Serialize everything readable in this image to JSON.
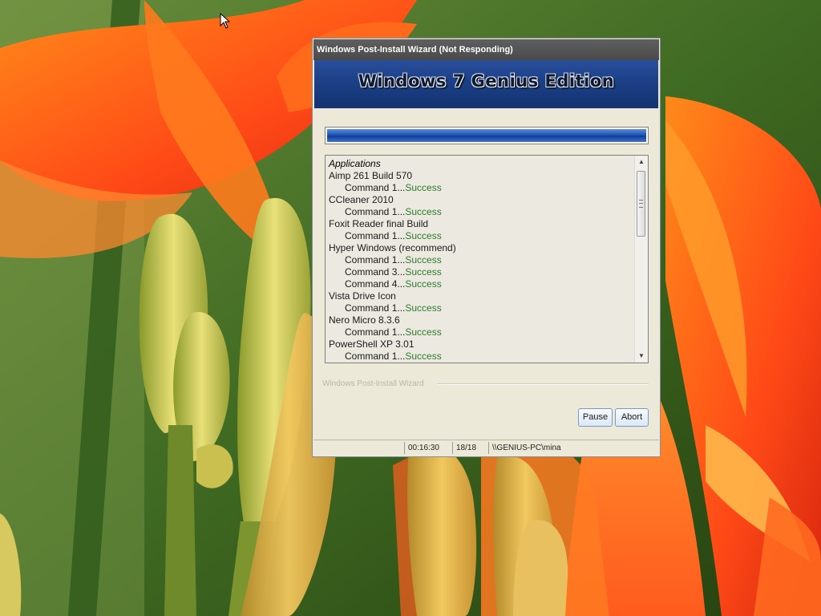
{
  "window": {
    "title": "Windows Post-Install Wizard (Not Responding)",
    "banner_title": "Windows 7 Genius Edition"
  },
  "progress": {
    "value_percent": 100
  },
  "log": {
    "rows": [
      {
        "kind": "header",
        "text": "Applications"
      },
      {
        "kind": "app",
        "text": "Aimp 261 Build 570"
      },
      {
        "kind": "cmd",
        "text": "Command 1...",
        "status": "Success"
      },
      {
        "kind": "app",
        "text": "CCleaner 2010"
      },
      {
        "kind": "cmd",
        "text": "Command 1...",
        "status": "Success"
      },
      {
        "kind": "app",
        "text": "Foxit Reader final Build"
      },
      {
        "kind": "cmd",
        "text": "Command 1...",
        "status": "Success"
      },
      {
        "kind": "app",
        "text": "Hyper Windows (recommend)"
      },
      {
        "kind": "cmd",
        "text": "Command 1...",
        "status": "Success"
      },
      {
        "kind": "cmd",
        "text": "Command 3...",
        "status": "Success"
      },
      {
        "kind": "cmd",
        "text": "Command 4...",
        "status": "Success"
      },
      {
        "kind": "app",
        "text": "Vista Drive Icon"
      },
      {
        "kind": "cmd",
        "text": "Command 1...",
        "status": "Success"
      },
      {
        "kind": "app",
        "text": "Nero Micro 8.3.6"
      },
      {
        "kind": "cmd",
        "text": "Command 1...",
        "status": "Success"
      },
      {
        "kind": "app",
        "text": "PowerShell XP 3.01"
      },
      {
        "kind": "cmd",
        "text": "Command 1...",
        "status": "Success"
      }
    ]
  },
  "groupbox": {
    "label": "Windows Post-Install Wizard"
  },
  "buttons": {
    "pause": "Pause",
    "abort": "Abort"
  },
  "statusbar": {
    "elapsed": "00:16:30",
    "count": "18/18",
    "user": "\\\\GENIUS-PC\\mina"
  },
  "colors": {
    "status_success": "#2f7a2f",
    "banner_blue": "#1c3f86",
    "titlebar": "#4a4a4a"
  },
  "icons": {
    "scroll_up": "▲",
    "scroll_down": "▼"
  }
}
